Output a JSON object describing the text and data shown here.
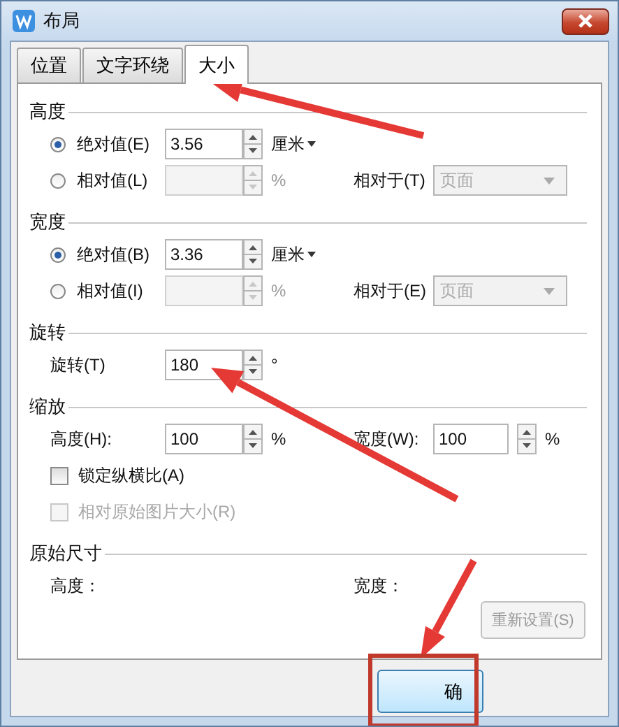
{
  "window": {
    "title": "布局"
  },
  "tabs": [
    {
      "label": "位置",
      "selected": false
    },
    {
      "label": "文字环绕",
      "selected": false
    },
    {
      "label": "大小",
      "selected": true
    }
  ],
  "sections": [
    {
      "title": "高度",
      "rows": [
        {
          "kind": "radio",
          "label": "绝对值(E)",
          "selected": true,
          "value": "3.56",
          "field_disabled": false,
          "unit": "厘米",
          "unit_dropdown": true
        },
        {
          "kind": "radio",
          "label": "相对值(L)",
          "selected": false,
          "field_disabled": true,
          "unit": "%",
          "relative": {
            "label": "相对于(T)",
            "value": "页面",
            "disabled": true
          }
        }
      ]
    },
    {
      "title": "宽度",
      "rows": [
        {
          "kind": "radio",
          "label": "绝对值(B)",
          "selected": true,
          "value": "3.36",
          "field_disabled": false,
          "unit": "厘米",
          "unit_dropdown": true
        },
        {
          "kind": "radio",
          "label": "相对值(I)",
          "selected": false,
          "field_disabled": true,
          "unit": "%",
          "relative": {
            "label": "相对于(E)",
            "value": "页面",
            "disabled": true
          }
        }
      ]
    },
    {
      "title": "旋转",
      "rows": [
        {
          "kind": "spin",
          "items": [
            {
              "label": "旋转(T)",
              "value": "180",
              "unit": "°"
            }
          ]
        }
      ]
    },
    {
      "title": "缩放",
      "rows": [
        {
          "kind": "spin",
          "items": [
            {
              "label": "高度(H):",
              "value": "100",
              "unit": "%"
            },
            {
              "label": "宽度(W):",
              "value": "100",
              "unit": "%"
            }
          ]
        },
        {
          "kind": "checkbox",
          "label": "锁定纵横比(A)",
          "checked": false,
          "disabled": false
        },
        {
          "kind": "checkbox",
          "label": "相对原始图片大小(R)",
          "checked": false,
          "disabled": true
        }
      ]
    },
    {
      "title": "原始尺寸",
      "rows": [
        {
          "kind": "info",
          "items": [
            {
              "label": "高度："
            },
            {
              "label": "宽度："
            }
          ]
        }
      ]
    }
  ],
  "reset_button": {
    "label": "重新设置(S)",
    "disabled": true
  },
  "ok_button": {
    "label": "确"
  }
}
